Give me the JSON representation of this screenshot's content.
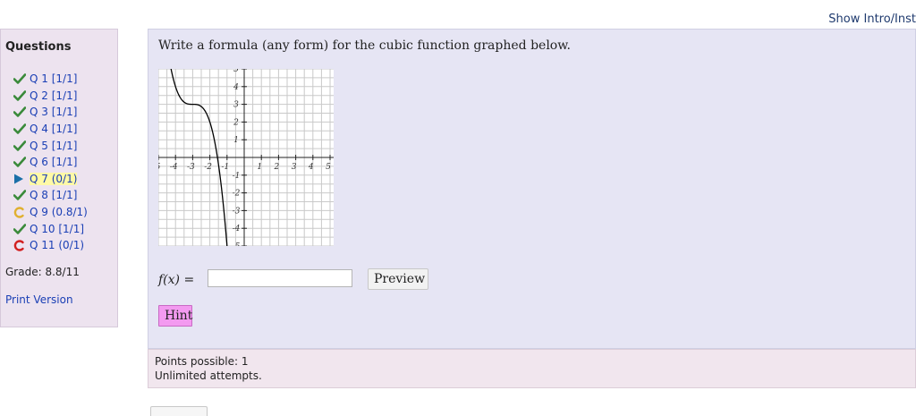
{
  "header": {
    "show_intro_link": "Show Intro/Inst"
  },
  "sidebar": {
    "title": "Questions",
    "questions": [
      {
        "label": "Q 1",
        "score": "[1/1]",
        "status": "correct"
      },
      {
        "label": "Q 2",
        "score": "[1/1]",
        "status": "correct"
      },
      {
        "label": "Q 3",
        "score": "[1/1]",
        "status": "correct"
      },
      {
        "label": "Q 4",
        "score": "[1/1]",
        "status": "correct"
      },
      {
        "label": "Q 5",
        "score": "[1/1]",
        "status": "correct"
      },
      {
        "label": "Q 6",
        "score": "[1/1]",
        "status": "correct"
      },
      {
        "label": "Q 7",
        "score": "(0/1)",
        "status": "current"
      },
      {
        "label": "Q 8",
        "score": "[1/1]",
        "status": "correct"
      },
      {
        "label": "Q 9",
        "score": "(0.8/1)",
        "status": "partial"
      },
      {
        "label": "Q 10",
        "score": "[1/1]",
        "status": "correct"
      },
      {
        "label": "Q 11",
        "score": "(0/1)",
        "status": "retry"
      }
    ],
    "grade": "Grade: 8.8/11",
    "print_version": "Print Version",
    "icons": {
      "correct": "checkmark-icon",
      "current": "play-arrow-icon",
      "partial": "retry-partial-icon",
      "retry": "retry-icon"
    },
    "colors": {
      "correct": "#3a8a3a",
      "current": "#1a6fa8",
      "partial": "#e0b030",
      "retry": "#d22020",
      "link": "#1a3fb5"
    }
  },
  "question": {
    "text": "Write a formula (any form) for the cubic function graphed below.",
    "graph": {
      "x_ticks": [
        "-5",
        "-4",
        "-3",
        "-2",
        "-1",
        "1",
        "2",
        "3",
        "4",
        "5"
      ],
      "y_ticks": [
        "5",
        "4",
        "3",
        "2",
        "1",
        "-1",
        "-2",
        "-3",
        "-4",
        "-5"
      ],
      "xlim": [
        -5,
        5
      ],
      "ylim": [
        -5,
        5
      ],
      "grid": true,
      "curve_description": "cubic decreasing, flat inflection near (-3, 3)"
    },
    "answer": {
      "label": "f(x) =",
      "value": ""
    },
    "preview_button": "Preview",
    "hint_button": "Hint"
  },
  "points": {
    "possible": "Points possible: 1",
    "attempts": "Unlimited attempts."
  }
}
